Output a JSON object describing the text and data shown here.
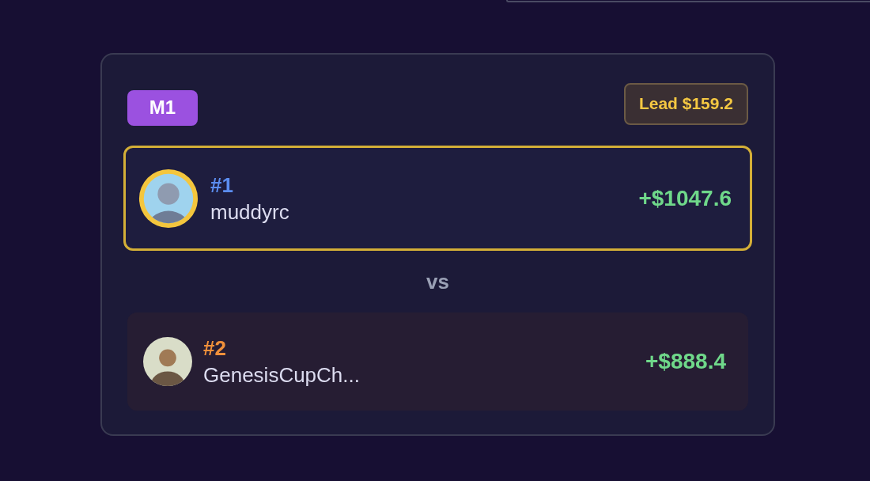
{
  "match": {
    "label": "M1",
    "lead": "Lead $159.2",
    "separator": "vs",
    "players": [
      {
        "rank": "#1",
        "color": "#5b8def",
        "name": "muddyrc",
        "profit": "+$1047.6",
        "leading": true
      },
      {
        "rank": "#2",
        "color": "#f0903a",
        "name": "GenesisCupCh...",
        "profit": "+$888.4",
        "leading": false
      }
    ]
  }
}
